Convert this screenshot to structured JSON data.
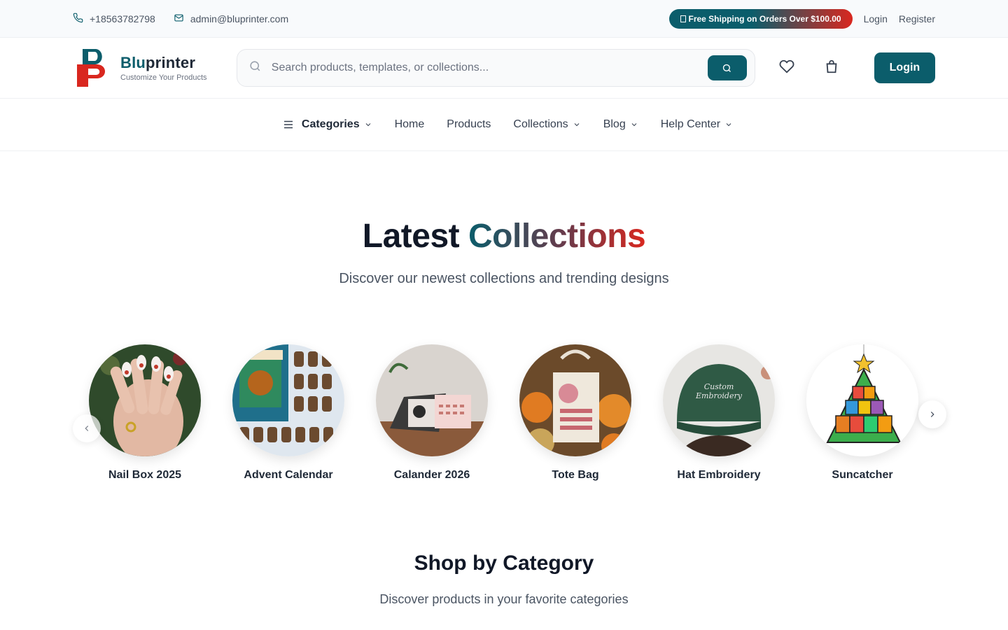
{
  "topbar": {
    "phone": "+18563782798",
    "email": "admin@bluprinter.com",
    "promo": "Free Shipping on Orders Over $100.00",
    "login": "Login",
    "register": "Register"
  },
  "brand": {
    "name_prefix": "Blu",
    "name_suffix": "printer",
    "tagline": "Customize Your Products"
  },
  "search": {
    "placeholder": "Search products, templates, or collections..."
  },
  "header": {
    "login_label": "Login",
    "icons": [
      "heart-icon",
      "bag-icon"
    ]
  },
  "nav": {
    "categories": "Categories",
    "home": "Home",
    "products": "Products",
    "collections": "Collections",
    "blog": "Blog",
    "help": "Help Center"
  },
  "latest": {
    "title_plain": "Latest",
    "title_accent": "Collections",
    "subtitle": "Discover our newest collections and trending designs",
    "items": [
      {
        "label": "Nail Box 2025"
      },
      {
        "label": "Advent Calendar"
      },
      {
        "label": "Calander 2026"
      },
      {
        "label": "Tote Bag"
      },
      {
        "label": "Hat Embroidery"
      },
      {
        "label": "Suncatcher"
      }
    ]
  },
  "hat_text": {
    "line1": "Custom",
    "line2": "Embroidery"
  },
  "shop": {
    "title": "Shop by Category",
    "subtitle": "Discover products in your favorite categories"
  },
  "colors": {
    "primary": "#0b5d6b",
    "accent": "#d9271f"
  }
}
